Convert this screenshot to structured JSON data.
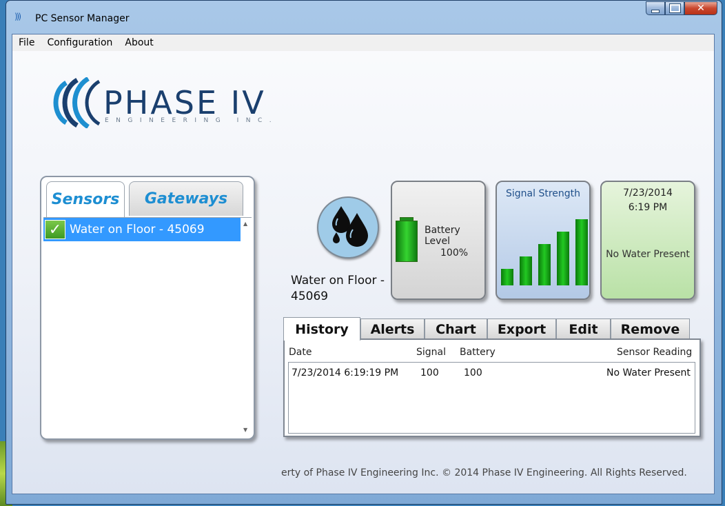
{
  "window": {
    "title": "PC Sensor Manager"
  },
  "menu": {
    "items": [
      "File",
      "Configuration",
      "About"
    ]
  },
  "logo": {
    "name": "PHASE IV",
    "subtitle": "ENGINEERING INC."
  },
  "sensor_tabs": {
    "sensors": "Sensors",
    "gateways": "Gateways"
  },
  "sensor_list": {
    "items": [
      {
        "label": "Water on Floor - 45069",
        "status_icon": "check-icon"
      }
    ]
  },
  "sensor": {
    "name": "Water on Floor - 45069",
    "icon": "water-drops-icon",
    "battery_label": "Battery Level",
    "battery_value": "100%",
    "signal_label": "Signal Strength",
    "signal_level": 5,
    "signal_max": 5,
    "last_date": "7/23/2014",
    "last_time": "6:19 PM",
    "last_reading": "No Water Present",
    "colors": {
      "battery": "#22c822",
      "signal_card": "#b3c9e6",
      "status_card": "#b9e1a6"
    }
  },
  "detail_tabs": [
    "History",
    "Alerts",
    "Chart",
    "Export",
    "Edit",
    "Remove"
  ],
  "history": {
    "columns": {
      "date": "Date",
      "signal": "Signal",
      "battery": "Battery",
      "reading": "Sensor Reading"
    },
    "rows": [
      {
        "date": "7/23/2014 6:19:19 PM",
        "signal": "100",
        "battery": "100",
        "reading": "No Water Present"
      }
    ]
  },
  "footer": "erty of Phase IV Engineering Inc.  © 2014 Phase IV Engineering. All Rights Reserved."
}
